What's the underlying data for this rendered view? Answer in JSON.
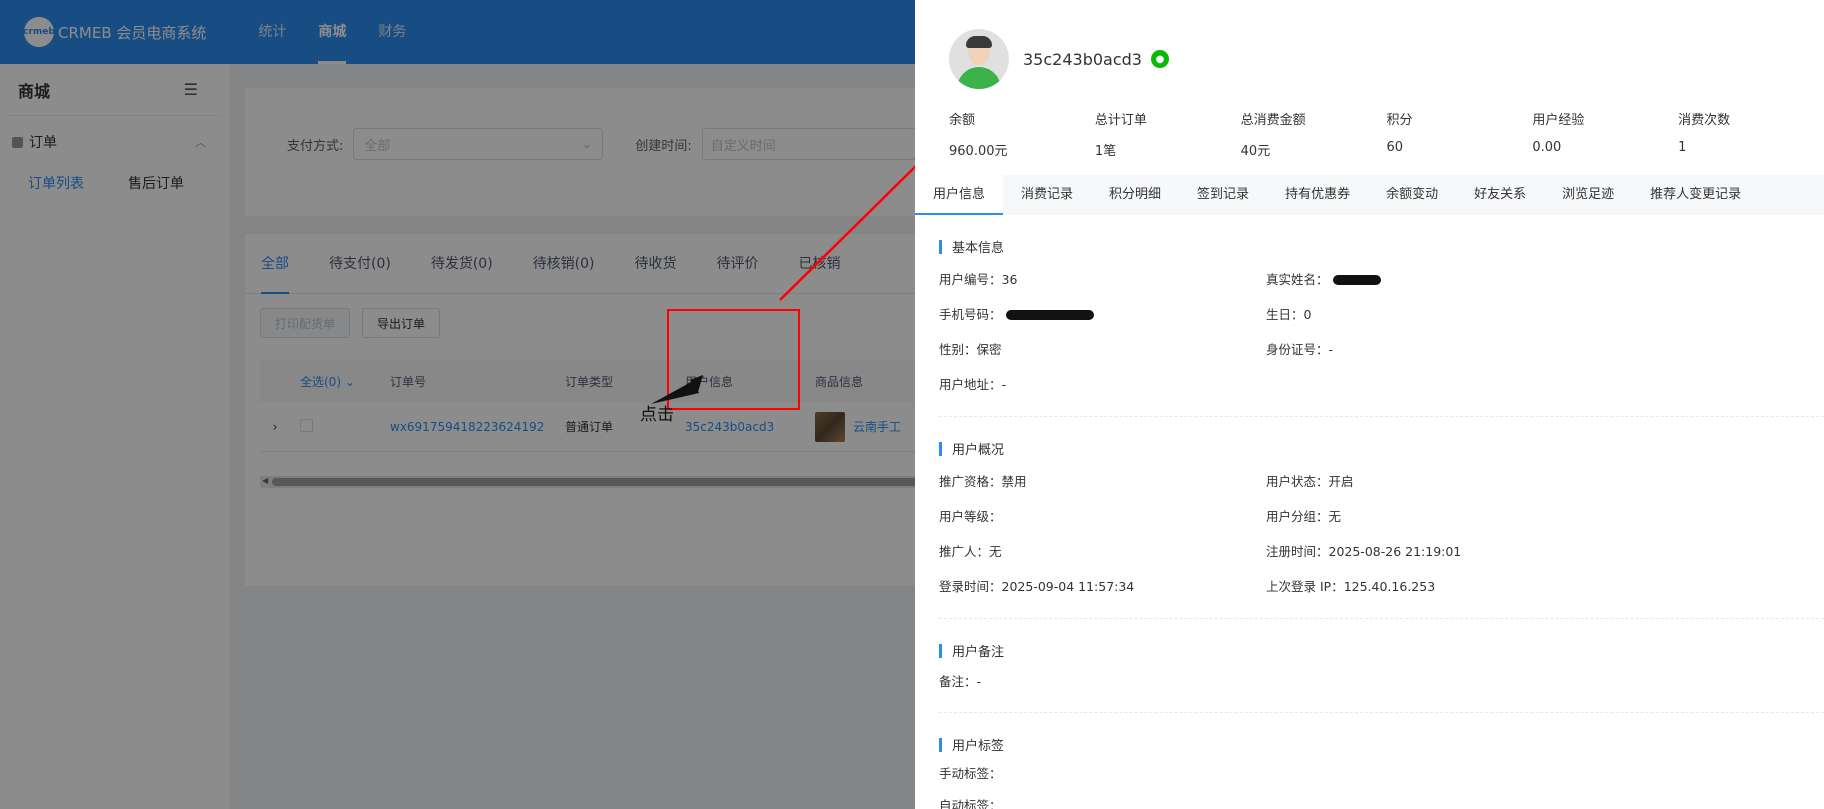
{
  "header": {
    "logo_mark": "crmeb",
    "app_title": "CRMEB 会员电商系统",
    "nav": [
      "统计",
      "商城",
      "财务"
    ],
    "active_nav": "商城"
  },
  "sidebar": {
    "title": "商城",
    "group": "订单",
    "items": [
      "订单列表",
      "售后订单"
    ]
  },
  "filters": {
    "pay_label": "支付方式:",
    "pay_value": "全部",
    "time_label": "创建时间:",
    "time_placeholder": "自定义时间"
  },
  "order_tabs": [
    "全部",
    "待支付(0)",
    "待发货(0)",
    "待核销(0)",
    "待收货",
    "待评价",
    "已核销"
  ],
  "buttons": {
    "print": "打印配货单",
    "export": "导出订单"
  },
  "table": {
    "headers": [
      "全选(0)",
      "订单号",
      "订单类型",
      "用户信息",
      "商品信息"
    ],
    "row": {
      "order_no": "wx691759418223624192",
      "order_type": "普通订单",
      "user": "35c243b0acd3",
      "product": "云南手工"
    }
  },
  "annotation": {
    "click_label": "点击",
    "box_color": "#ff0000"
  },
  "drawer": {
    "username": "35c243b0acd3",
    "stats": [
      {
        "label": "余额",
        "value": "960.00元"
      },
      {
        "label": "总计订单",
        "value": "1笔"
      },
      {
        "label": "总消费金额",
        "value": "40元"
      },
      {
        "label": "积分",
        "value": "60"
      },
      {
        "label": "用户经验",
        "value": "0.00"
      },
      {
        "label": "消费次数",
        "value": "1"
      }
    ],
    "tabs": [
      "用户信息",
      "消费记录",
      "积分明细",
      "签到记录",
      "持有优惠券",
      "余额变动",
      "好友关系",
      "浏览足迹",
      "推荐人变更记录"
    ],
    "basic": {
      "title": "基本信息",
      "user_id": "用户编号：36",
      "real_name": "真实姓名：",
      "phone": "手机号码：",
      "birthday": "生日：0",
      "gender": "性别：保密",
      "id_card": "身份证号：-",
      "address": "用户地址：-"
    },
    "overview": {
      "title": "用户概况",
      "promo": "推广资格：禁用",
      "status": "用户状态：开启",
      "level": "用户等级：",
      "group": "用户分组：无",
      "promoter": "推广人：无",
      "register": "注册时间：2025-08-26 21:19:01",
      "login": "登录时间：2025-09-04 11:57:34",
      "last_ip": "上次登录 IP：125.40.16.253"
    },
    "remark": {
      "title": "用户备注",
      "text": "备注：-"
    },
    "tags": {
      "title": "用户标签",
      "manual": "手动标签：",
      "auto": "自动标签："
    }
  }
}
